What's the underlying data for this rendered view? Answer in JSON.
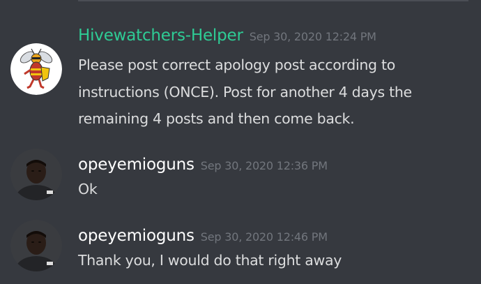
{
  "colors": {
    "background": "#36393f",
    "helper_name": "#2ecc95",
    "user_name": "#ffffff",
    "timestamp": "#72767d",
    "text": "#dcddde"
  },
  "messages": [
    {
      "author": "Hivewatchers-Helper",
      "timestamp": "Sep 30, 2020 12:24 PM",
      "avatar_icon": "hornet-mascot-icon",
      "text": "Please post correct apology post according to instructions (ONCE). Post for another 4 days the remaining 4 posts and then come back."
    },
    {
      "author": "opeyemioguns",
      "timestamp": "Sep 30, 2020 12:36 PM",
      "avatar_icon": "user-photo-avatar",
      "text": "Ok"
    },
    {
      "author": "opeyemioguns",
      "timestamp": "Sep 30, 2020 12:46 PM",
      "avatar_icon": "user-photo-avatar",
      "text": "Thank you, I would do that right away"
    }
  ]
}
